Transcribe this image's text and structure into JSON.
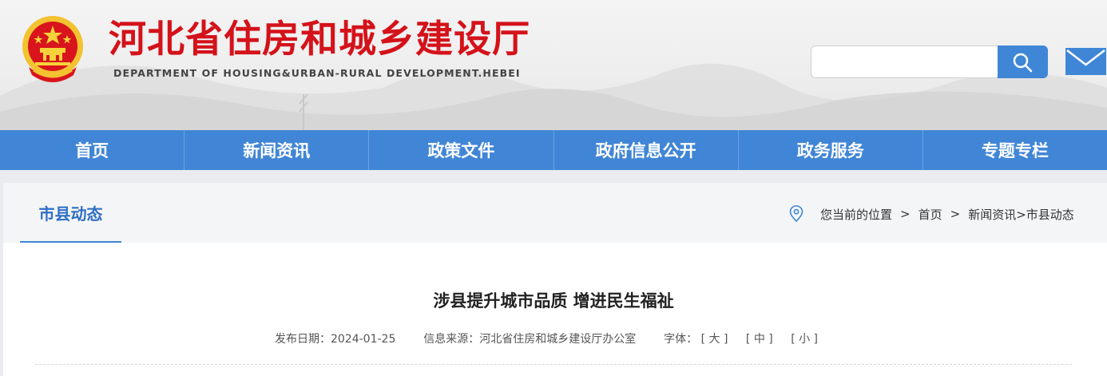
{
  "header": {
    "title": "河北省住房和城乡建设厅",
    "subtitle": "DEPARTMENT OF HOUSING&URBAN-RURAL DEVELOPMENT.HEBEI",
    "search_placeholder": "",
    "search_icon": "magnifier-icon",
    "mail_icon": "envelope-icon",
    "emblem_icon": "national-emblem"
  },
  "nav": {
    "items": [
      "首页",
      "新闻资讯",
      "政策文件",
      "政府信息公开",
      "政务服务",
      "专题专栏"
    ]
  },
  "section": {
    "title": "市县动态"
  },
  "breadcrumb": {
    "label": "您当前的位置",
    "sep": ">",
    "home": "首页",
    "path": "新闻资讯>市县动态"
  },
  "article": {
    "title": "涉县提升城市品质 增进民生福祉",
    "date": "发布日期：2024-01-25",
    "source": "信息来源：河北省住房和城乡建设厅办公室",
    "font_label": "字体：",
    "font_large": "[ 大 ]",
    "font_medium": "[ 中 ]",
    "font_small": "[ 小 ]"
  },
  "colors": {
    "brand_red": "#d4121a",
    "nav_blue": "#4186d6",
    "accent_blue": "#3f86d6"
  }
}
